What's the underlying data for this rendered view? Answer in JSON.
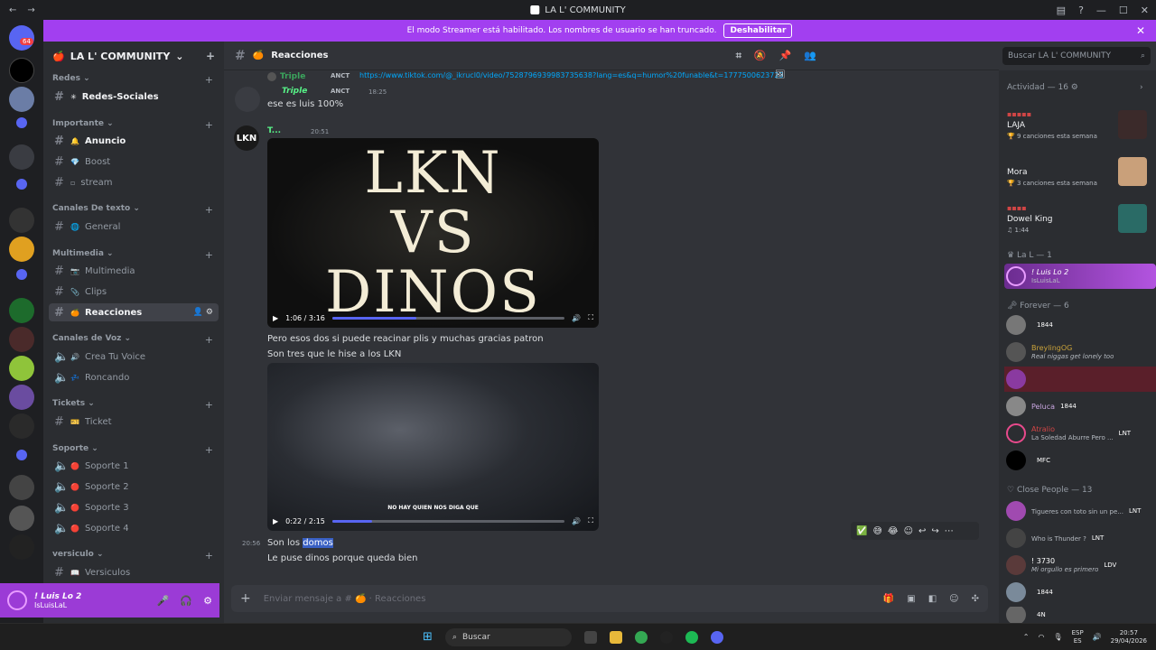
{
  "titlebar": {
    "title": "LA L' COMMUNITY",
    "back": "←",
    "forward": "→",
    "icons": [
      "inbox-icon",
      "help-icon"
    ],
    "minimize": "—",
    "maximize": "☐",
    "close": "✕"
  },
  "streamer_banner": {
    "text": "El modo Streamer está habilitado. Los nombres de usuario se han truncado.",
    "button": "Deshabilitar",
    "close": "✕"
  },
  "servers": {
    "badge": "64"
  },
  "guild": {
    "name": "LA L' COMMUNITY",
    "chevron": "⌄"
  },
  "categories": [
    {
      "label": "Redes"
    },
    {
      "label": "Importante"
    },
    {
      "label": "Canales De texto"
    },
    {
      "label": "Multimedia"
    },
    {
      "label": "Canales de Voz"
    },
    {
      "label": "Tickets"
    },
    {
      "label": "Soporte"
    },
    {
      "label": "versiculo"
    }
  ],
  "channels": [
    {
      "label": "Redes-Sociales",
      "emoji": "✳"
    },
    {
      "label": "Anuncio",
      "emoji": "🔔"
    },
    {
      "label": "Boost",
      "emoji": "💎"
    },
    {
      "label": "stream",
      "emoji": "▫"
    },
    {
      "label": "General",
      "emoji": "🌐"
    },
    {
      "label": "Multimedia",
      "emoji": "📷"
    },
    {
      "label": "Clips",
      "emoji": "📎"
    },
    {
      "label": "Reacciones",
      "emoji": "🍊"
    },
    {
      "label": "Crea Tu Voice",
      "emoji": "🔊"
    },
    {
      "label": "Roncando",
      "emoji": "💤"
    },
    {
      "label": "Ticket",
      "emoji": "🎫"
    },
    {
      "label": "Soporte 1",
      "emoji": "🔴"
    },
    {
      "label": "Soporte 2",
      "emoji": "🔴"
    },
    {
      "label": "Soporte 3",
      "emoji": "🔴"
    },
    {
      "label": "Soporte 4",
      "emoji": "🔴"
    },
    {
      "label": "Versiculos",
      "emoji": "📖"
    }
  ],
  "user_panel": {
    "name": "! Luis Lo 2",
    "tag": "IsLuisLaL"
  },
  "channel_header": {
    "name": "Reacciones",
    "emoji": "🍊"
  },
  "search": {
    "placeholder": "Buscar LA L' COMMUNITY"
  },
  "messages": {
    "reply_user": "Triple",
    "reply_badge": "ANCT",
    "reply_link": "https://www.tiktok.com/@_ikrucl0/video/7528796939983735638?lang=es&q=humor%20funable&t=1777500623723",
    "m1_user": "Triple",
    "m1_badge": "ANCT",
    "m1_time": "18:25",
    "m1_text": "ese es luis 100%",
    "m2_user": "T...",
    "m2_time": "20:51",
    "avatar_text": "LKN",
    "video1_lines": [
      "LKN",
      "VS",
      "DINOS"
    ],
    "video1_time": "1:06 / 3:16",
    "video1_progress": 0.36,
    "m2_text1": "Pero esos dos si puede reacinar plis y muchas gracias patron",
    "m2_text2": "Son tres que le hise a los LKN",
    "video2_subtitle": "NO HAY QUIEN NOS DIGA QUE",
    "video2_time": "0:22 / 2:15",
    "video2_progress": 0.17,
    "m3_time": "20:56",
    "m3_text_a": "Son  los",
    "m3_text_b": "domos",
    "m4_text": "Le puse dinos porque queda bien"
  },
  "composer": {
    "placeholder": "Enviar mensaje a #",
    "channel": "Reacciones"
  },
  "activity": {
    "header": "Actividad — 16",
    "items": [
      {
        "title": "LAJA",
        "sub": "9 canciones esta semana"
      },
      {
        "title": "Mora",
        "sub": "3 canciones esta semana"
      },
      {
        "title": "Dowel King",
        "sub": "1:44"
      }
    ]
  },
  "member_groups": [
    {
      "label": "La L — 1"
    },
    {
      "label": "Forever — 6"
    },
    {
      "label": "Close People — 13"
    }
  ],
  "members": [
    {
      "name": "! Luis Lo 2",
      "sub": "IsLuisLaL",
      "badge": ""
    },
    {
      "name": "",
      "sub": "",
      "badge": "1844"
    },
    {
      "name": "BreylingOG",
      "sub": "Real niggas get lonely too",
      "badge": ""
    },
    {
      "name": "",
      "sub": "",
      "badge": ""
    },
    {
      "name": "Peluca",
      "sub": "",
      "badge": "1844"
    },
    {
      "name": "Atralio",
      "sub": "La Soledad Aburre Pero ...",
      "badge": "LNT"
    },
    {
      "name": "",
      "sub": "",
      "badge": "MFC"
    },
    {
      "name": "",
      "sub": "Tigueres con toto sin un pe...",
      "badge": "LNT"
    },
    {
      "name": "",
      "sub": "Who is Thunder ?",
      "badge": "LNT"
    },
    {
      "name": "! 3730",
      "sub": "Mi orgullo es primero",
      "badge": "LDV"
    },
    {
      "name": "",
      "sub": "",
      "badge": "1844"
    },
    {
      "name": "",
      "sub": "",
      "badge": "4N"
    }
  ],
  "taskbar": {
    "search": "Buscar",
    "lang1": "ESP",
    "lang2": "ES",
    "time": "20:57",
    "date": "29/04/2026"
  }
}
